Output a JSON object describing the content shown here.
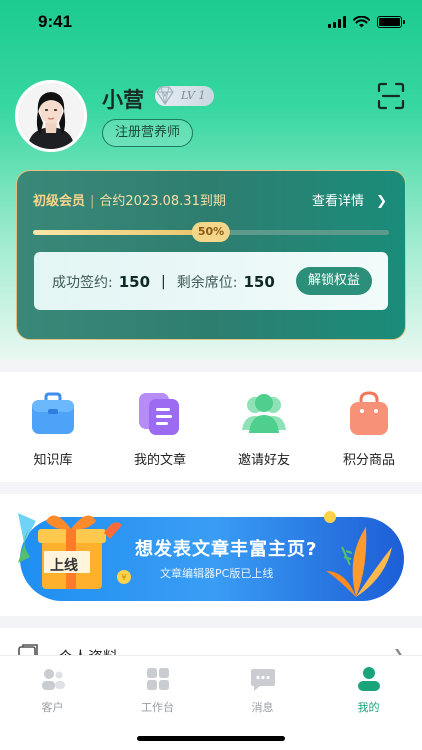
{
  "status_bar": {
    "time": "9:41"
  },
  "profile": {
    "name": "小营",
    "level": "LV 1",
    "register_tag": "注册营养师",
    "avatar_icon": "avatar-photo",
    "scan_icon": "scan-icon"
  },
  "member_card": {
    "grade": "初级会员",
    "expiry": "合约2023.08.31到期",
    "details_link": "查看详情",
    "progress": 0.5,
    "progress_label": "50%",
    "signed_label": "成功签约:",
    "signed_value": "150",
    "seats_label": "剩余席位:",
    "seats_value": "150",
    "unlock_button": "解锁权益",
    "accent_gold": "#f3d68a"
  },
  "shortcuts": [
    {
      "label": "知识库",
      "icon": "briefcase-icon"
    },
    {
      "label": "我的文章",
      "icon": "document-icon"
    },
    {
      "label": "邀请好友",
      "icon": "friends-icon"
    },
    {
      "label": "积分商品",
      "icon": "shopping-bag-icon"
    }
  ],
  "banner": {
    "title": "想发表文章丰富主页?",
    "subtitle": "文章编辑器PC版已上线",
    "badge_text": "上线"
  },
  "list": {
    "item_label": "个人资料"
  },
  "tab_bar": {
    "tabs": [
      {
        "label": "客户",
        "icon": "customers-icon",
        "active": false
      },
      {
        "label": "工作台",
        "icon": "workbench-icon",
        "active": false
      },
      {
        "label": "消息",
        "icon": "message-icon",
        "active": false
      },
      {
        "label": "我的",
        "icon": "profile-icon",
        "active": true
      }
    ],
    "active_color": "#1aa47c",
    "inactive_color": "#c9ccd0"
  }
}
